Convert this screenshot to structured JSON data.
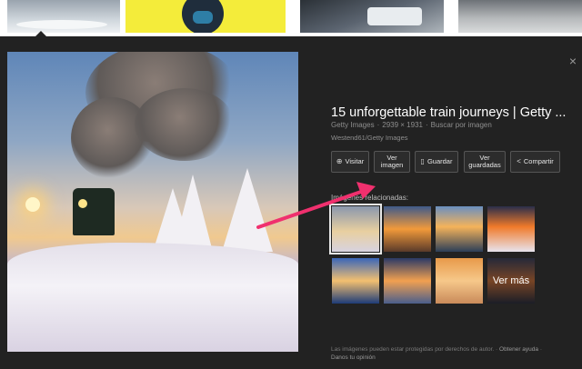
{
  "strip": {
    "thumbnails": [
      "snow-landscape-thumbnail",
      "yellow-portrait-thumbnail",
      "dark-photo-thumbnail",
      "grey-photo-thumbnail"
    ]
  },
  "preview": {
    "title": "15 unforgettable train journeys | Getty ...",
    "source": "Getty Images",
    "dimensions": "2939 × 1931",
    "search_by_image": "Buscar por imagen",
    "credit": "Westend61/Getty Images",
    "close_icon": "×"
  },
  "actions": {
    "visit": "Visitar",
    "view_line1": "Ver",
    "view_line2": "imagen",
    "save": "Guardar",
    "saved_line1": "Ver",
    "saved_line2": "guardadas",
    "share": "Compartir"
  },
  "related": {
    "label": "Imágenes relacionadas:",
    "more": "Ver más",
    "count": 8
  },
  "footer": {
    "notice": "Las imágenes pueden estar protegidas por derechos de autor.",
    "help": "Obtener ayuda",
    "feedback": "Danos tu opinión"
  },
  "colors": {
    "panel_bg": "#222222",
    "arrow": "#f0306e"
  },
  "icons": {
    "visit": "globe-icon",
    "save": "bookmark-icon",
    "share": "share-icon",
    "close": "close-icon"
  }
}
